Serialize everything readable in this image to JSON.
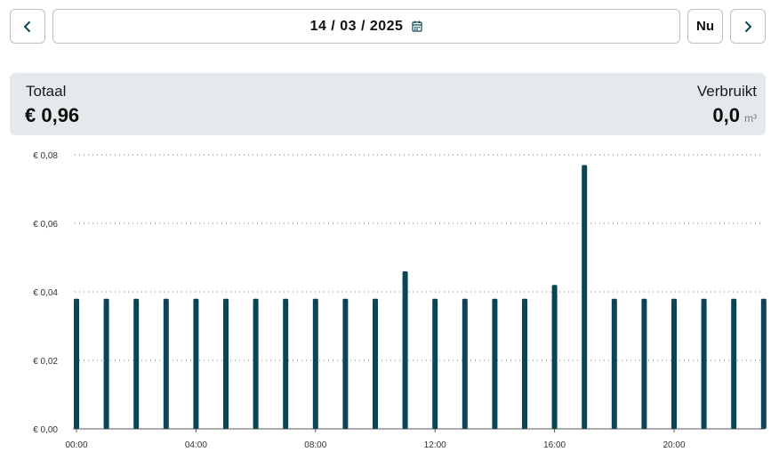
{
  "nav": {
    "prev_icon": "chevron-left-icon",
    "next_icon": "chevron-right-icon",
    "date": "14 / 03 / 2025",
    "calendar_icon": "calendar-icon",
    "now_label": "Nu"
  },
  "summary": {
    "total_label": "Totaal",
    "total_value": "€ 0,96",
    "usage_label": "Verbruikt",
    "usage_value": "0,0",
    "usage_unit": "m³"
  },
  "colors": {
    "bar": "#0b4553",
    "accent": "#0b4553",
    "summary_bg": "#e4eaeb"
  },
  "chart_data": {
    "type": "bar",
    "x": [
      "00:00",
      "01:00",
      "02:00",
      "03:00",
      "04:00",
      "05:00",
      "06:00",
      "07:00",
      "08:00",
      "09:00",
      "10:00",
      "11:00",
      "12:00",
      "13:00",
      "14:00",
      "15:00",
      "16:00",
      "17:00",
      "18:00",
      "19:00",
      "20:00",
      "21:00",
      "22:00",
      "23:00"
    ],
    "values": [
      0.038,
      0.038,
      0.038,
      0.038,
      0.038,
      0.038,
      0.038,
      0.038,
      0.038,
      0.038,
      0.038,
      0.046,
      0.038,
      0.038,
      0.038,
      0.038,
      0.042,
      0.077,
      0.038,
      0.038,
      0.038,
      0.038,
      0.038,
      0.038
    ],
    "x_tick_labels": [
      "00:00",
      "04:00",
      "08:00",
      "12:00",
      "16:00",
      "20:00"
    ],
    "y_ticks": [
      0,
      0.02,
      0.04,
      0.06,
      0.08
    ],
    "y_tick_labels": [
      "€ 0,00",
      "€ 0,02",
      "€ 0,04",
      "€ 0,06",
      "€ 0,08"
    ],
    "ylim": [
      0,
      0.08
    ],
    "grid": true,
    "title": "",
    "xlabel": "",
    "ylabel": ""
  }
}
